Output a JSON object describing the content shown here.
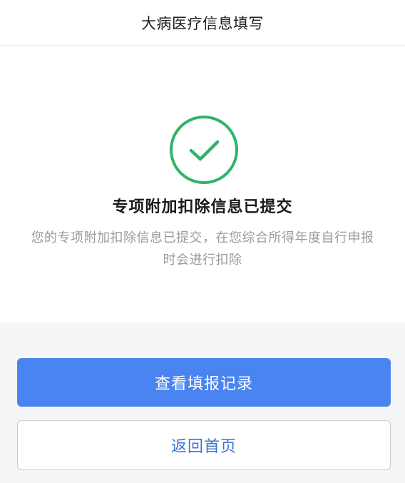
{
  "header": {
    "title": "大病医疗信息填写"
  },
  "result": {
    "icon": "check-circle-icon",
    "title": "专项附加扣除信息已提交",
    "description": "您的专项附加扣除信息已提交，在您综合所得年度自行申报时会进行扣除"
  },
  "actions": {
    "view_records_label": "查看填报记录",
    "back_home_label": "返回首页"
  },
  "colors": {
    "success_green": "#2fb36a",
    "primary_blue": "#4a84f1",
    "link_blue": "#3d72d9"
  }
}
